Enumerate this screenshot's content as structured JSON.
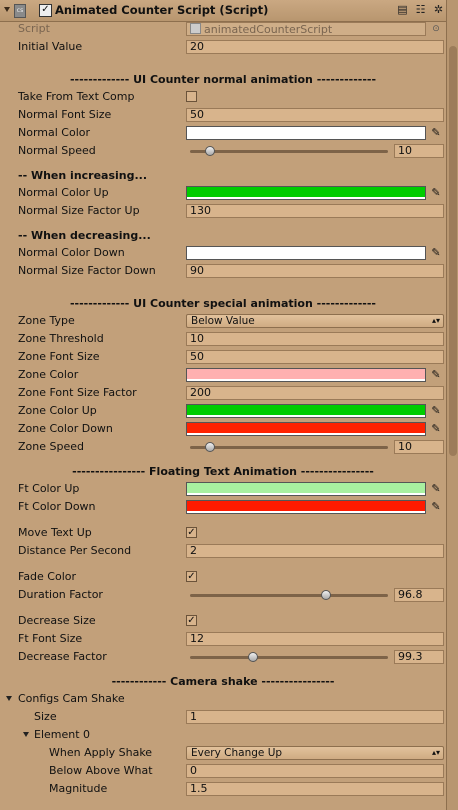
{
  "header": {
    "title": "Animated Counter Script (Script)",
    "enabled": "✓",
    "script_icon": "cs",
    "help_icon": "book-icon",
    "preset_icon": "sliders-icon",
    "gear_icon": "gear-icon"
  },
  "script": {
    "label": "Script",
    "value": "animatedCounterScript"
  },
  "initial_value": {
    "label": "Initial Value",
    "value": "20"
  },
  "normal_section": {
    "header": "------------- UI Counter normal animation -------------",
    "take_from_text": {
      "label": "Take From Text Comp",
      "checked": ""
    },
    "font_size": {
      "label": "Normal Font Size",
      "value": "50"
    },
    "color": {
      "label": "Normal Color",
      "color": "#ffffff"
    },
    "speed": {
      "label": "Normal Speed",
      "value": "10",
      "fraction": 0.1
    },
    "increasing_header": "-- When increasing...",
    "color_up": {
      "label": "Normal Color Up",
      "color": "#00cc00"
    },
    "size_up": {
      "label": "Normal Size Factor Up",
      "value": "130"
    },
    "decreasing_header": "-- When decreasing...",
    "color_down": {
      "label": "Normal Color Down",
      "color": "#ffffff"
    },
    "size_down": {
      "label": "Normal Size Factor Down",
      "value": "90"
    }
  },
  "special_section": {
    "header": "------------- UI Counter special animation -------------",
    "zone_type": {
      "label": "Zone Type",
      "value": "Below Value"
    },
    "zone_threshold": {
      "label": "Zone Threshold",
      "value": "10"
    },
    "zone_font_size": {
      "label": "Zone Font Size",
      "value": "50"
    },
    "zone_color": {
      "label": "Zone Color",
      "color": "#ffb0b0"
    },
    "zone_font_factor": {
      "label": "Zone Font Size Factor",
      "value": "200"
    },
    "zone_color_up": {
      "label": "Zone Color Up",
      "color": "#00cc00"
    },
    "zone_color_down": {
      "label": "Zone Color Down",
      "color": "#ff2200"
    },
    "zone_speed": {
      "label": "Zone Speed",
      "value": "10",
      "fraction": 0.1
    }
  },
  "floating_section": {
    "header": "---------------- Floating Text Animation ----------------",
    "ft_color_up": {
      "label": "Ft Color Up",
      "color": "#a8f0a0"
    },
    "ft_color_down": {
      "label": "Ft Color Down",
      "color": "#ff1a00"
    },
    "move_up": {
      "label": "Move Text Up",
      "checked": "✓"
    },
    "distance": {
      "label": "Distance Per Second",
      "value": "2"
    },
    "fade_color": {
      "label": "Fade Color",
      "checked": "✓"
    },
    "duration": {
      "label": "Duration Factor",
      "value": "96.8",
      "fraction": 0.685
    },
    "decrease_size": {
      "label": "Decrease Size",
      "checked": "✓"
    },
    "ft_font_size": {
      "label": "Ft Font Size",
      "value": "12"
    },
    "decrease_factor": {
      "label": "Decrease Factor",
      "value": "99.3",
      "fraction": 0.32
    }
  },
  "camera_section": {
    "header": "------------ Camera shake ----------------",
    "configs": {
      "label": "Configs Cam Shake"
    },
    "size": {
      "label": "Size",
      "value": "1"
    },
    "element0": {
      "label": "Element 0"
    },
    "when_apply": {
      "label": "When Apply Shake",
      "value": "Every Change Up"
    },
    "below_above": {
      "label": "Below Above What",
      "value": "0"
    },
    "magnitude": {
      "label": "Magnitude",
      "value": "1.5"
    }
  }
}
